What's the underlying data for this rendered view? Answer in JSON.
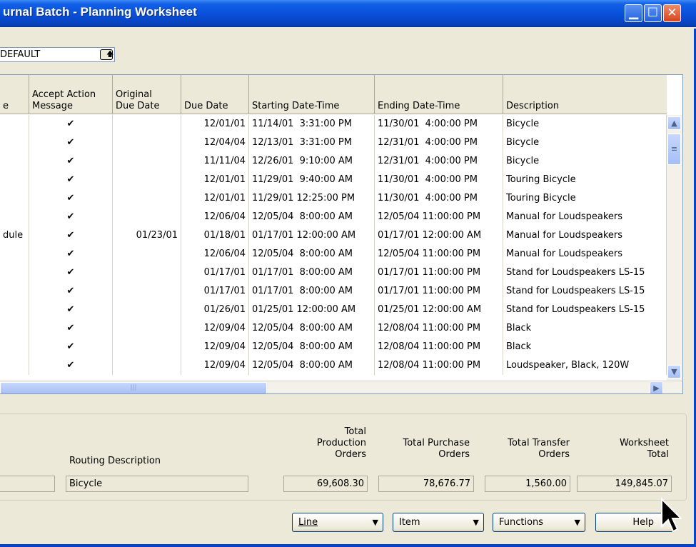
{
  "window": {
    "title": "urnal Batch - Planning Worksheet"
  },
  "batch_name": {
    "value": "DEFAULT"
  },
  "grid": {
    "headers": {
      "col0": "e",
      "accept": "Accept Action\nMessage",
      "orig_due": "Original\nDue Date",
      "due": "Due Date",
      "start": "Starting Date-Time",
      "end": "Ending Date-Time",
      "desc": "Description"
    },
    "check_glyph": "✔",
    "rows": [
      {
        "c0": "",
        "orig": "",
        "due": "12/01/01",
        "start": "11/14/01  3:31:00 PM",
        "end": "11/30/01  4:00:00 PM",
        "desc": "Bicycle"
      },
      {
        "c0": "",
        "orig": "",
        "due": "12/04/04",
        "start": "12/13/01  3:31:00 PM",
        "end": "12/31/01  4:00:00 PM",
        "desc": "Bicycle"
      },
      {
        "c0": "",
        "orig": "",
        "due": "11/11/04",
        "start": "12/26/01  9:10:00 AM",
        "end": "12/31/01  4:00:00 PM",
        "desc": "Bicycle"
      },
      {
        "c0": "",
        "orig": "",
        "due": "12/01/01",
        "start": "11/29/01  9:40:00 AM",
        "end": "11/30/01  4:00:00 PM",
        "desc": "Touring Bicycle"
      },
      {
        "c0": "",
        "orig": "",
        "due": "12/01/01",
        "start": "11/29/01 12:25:00 PM",
        "end": "11/30/01  4:00:00 PM",
        "desc": "Touring Bicycle"
      },
      {
        "c0": "",
        "orig": "",
        "due": "12/06/04",
        "start": "12/05/04  8:00:00 AM",
        "end": "12/05/04 11:00:00 PM",
        "desc": "Manual for Loudspeakers"
      },
      {
        "c0": "dule",
        "orig": "01/23/01",
        "due": "01/18/01",
        "start": "01/17/01 12:00:00 AM",
        "end": "01/17/01 12:00:00 AM",
        "desc": "Manual for Loudspeakers"
      },
      {
        "c0": "",
        "orig": "",
        "due": "12/06/04",
        "start": "12/05/04  8:00:00 AM",
        "end": "12/05/04 11:00:00 PM",
        "desc": "Manual for Loudspeakers"
      },
      {
        "c0": "",
        "orig": "",
        "due": "01/17/01",
        "start": "01/17/01  8:00:00 AM",
        "end": "01/17/01 11:00:00 PM",
        "desc": "Stand for Loudspeakers LS-15"
      },
      {
        "c0": "",
        "orig": "",
        "due": "01/17/01",
        "start": "01/17/01  8:00:00 AM",
        "end": "01/17/01 11:00:00 PM",
        "desc": "Stand for Loudspeakers LS-15"
      },
      {
        "c0": "",
        "orig": "",
        "due": "01/26/01",
        "start": "01/25/01 12:00:00 AM",
        "end": "01/25/01 12:00:00 AM",
        "desc": "Stand for Loudspeakers LS-15"
      },
      {
        "c0": "",
        "orig": "",
        "due": "12/09/04",
        "start": "12/05/04  8:00:00 AM",
        "end": "12/08/04 11:00:00 PM",
        "desc": "Black"
      },
      {
        "c0": "",
        "orig": "",
        "due": "12/09/04",
        "start": "12/05/04  8:00:00 AM",
        "end": "12/08/04 11:00:00 PM",
        "desc": "Black"
      },
      {
        "c0": "",
        "orig": "",
        "due": "12/09/04",
        "start": "12/05/04  8:00:00 AM",
        "end": "12/08/04 11:00:00 PM",
        "desc": "Loudspeaker, Black, 120W"
      }
    ]
  },
  "footer": {
    "routing_label": "Routing Description",
    "routing_value": "Bicycle",
    "prod_label": "Total\nProduction\nOrders",
    "prod_value": "69,608.30",
    "purch_label": "Total Purchase\nOrders",
    "purch_value": "78,676.77",
    "transfer_label": "Total Transfer\nOrders",
    "transfer_value": "1,560.00",
    "ws_label": "Worksheet\nTotal",
    "ws_value": "149,845.07"
  },
  "buttons": {
    "line": "Line",
    "item": "Item",
    "functions": "Functions",
    "help": "Help"
  },
  "icons": {
    "minimize": "minimize-icon",
    "maximize": "maximize-icon",
    "close": "close-icon",
    "lookup": "lookup-arrow-icon",
    "dropdown": "chevron-down-icon"
  }
}
